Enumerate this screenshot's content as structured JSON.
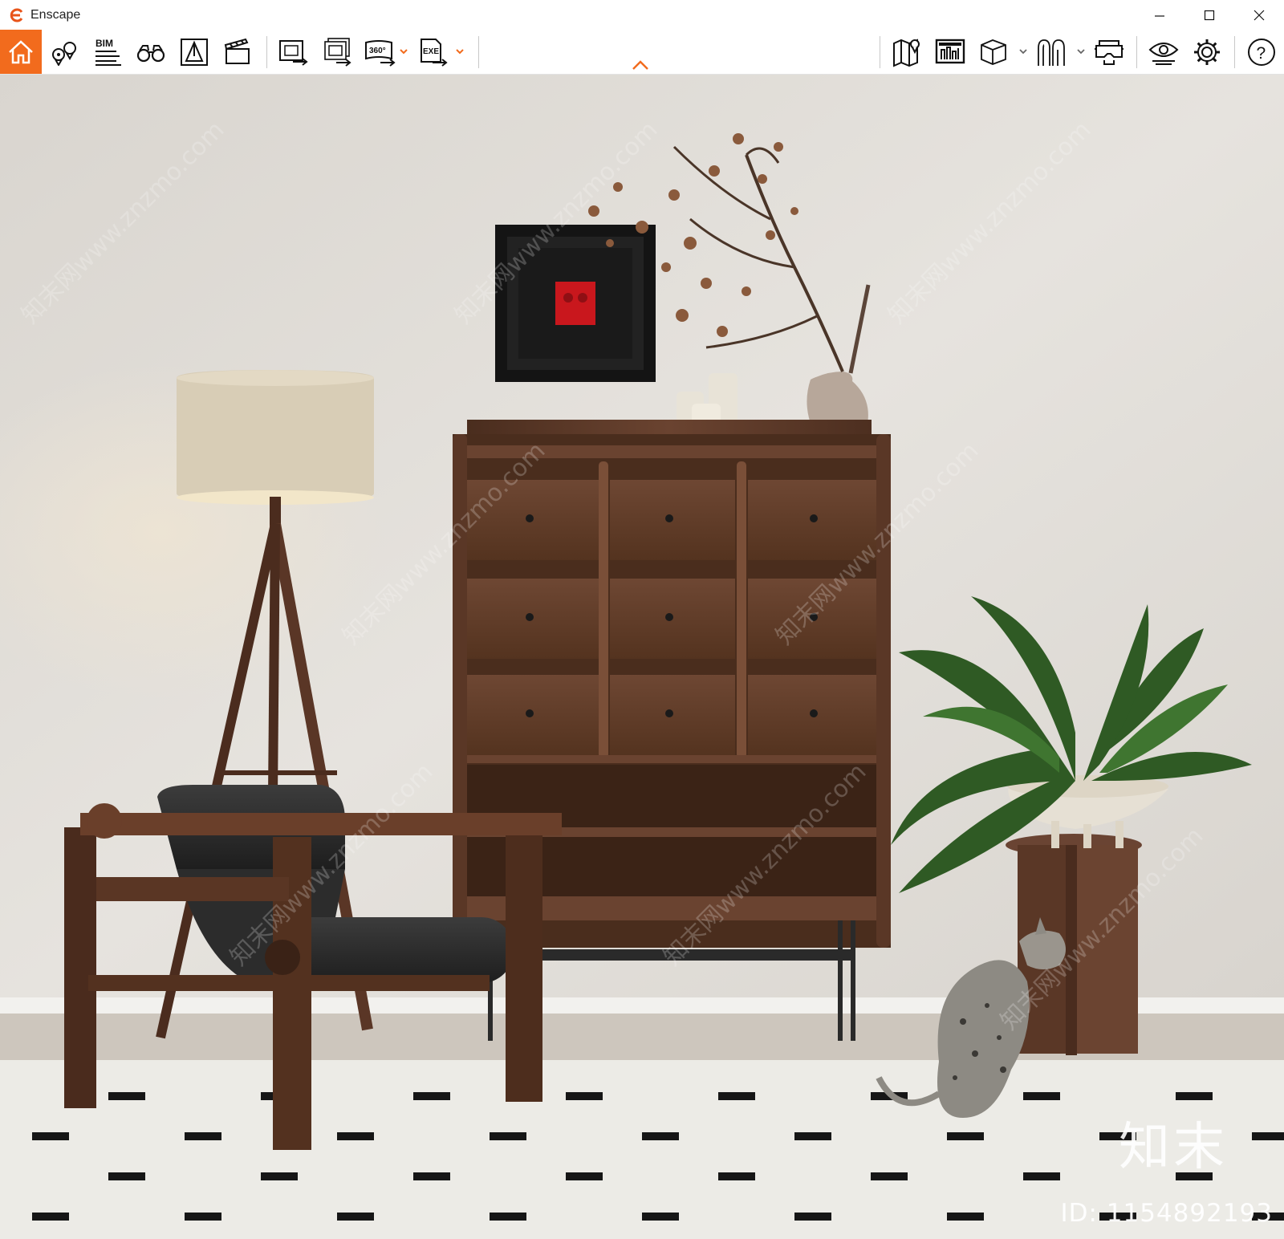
{
  "window": {
    "title": "Enscape",
    "controls": [
      "minimize",
      "maximize",
      "close"
    ]
  },
  "toolbar": {
    "left_icons": [
      "home-icon",
      "location-pins-icon",
      "bim-icon",
      "binoculars-icon",
      "perspective-icon",
      "clapperboard-icon"
    ],
    "bim_label": "BIM",
    "export_icons": [
      "export-screenshot-icon",
      "batch-render-icon",
      "export-panorama-icon",
      "export-exe-icon"
    ],
    "panorama_label": "360°",
    "exe_label": "EXE",
    "right_icons": [
      "map-icon",
      "asset-library-icon",
      "cube-view-icon",
      "arches-icon",
      "vr-headset-icon",
      "visual-settings-icon",
      "settings-gear-icon",
      "help-icon"
    ],
    "help_label": "?",
    "accent_color": "#f26b1d",
    "collapse_icon": "chevron-up-icon"
  },
  "viewport": {
    "scene": "rendered-interior",
    "objects": [
      "floor-lamp",
      "lounge-chair",
      "drawer-cabinet",
      "framed-artwork",
      "branch-vase",
      "candles",
      "potted-plant",
      "side-stool",
      "cat",
      "patterned-rug"
    ],
    "watermark_brand": "知末",
    "watermark_id": "ID: 1154892193",
    "diagonal_watermark": "知末网www.znzmo.com"
  }
}
